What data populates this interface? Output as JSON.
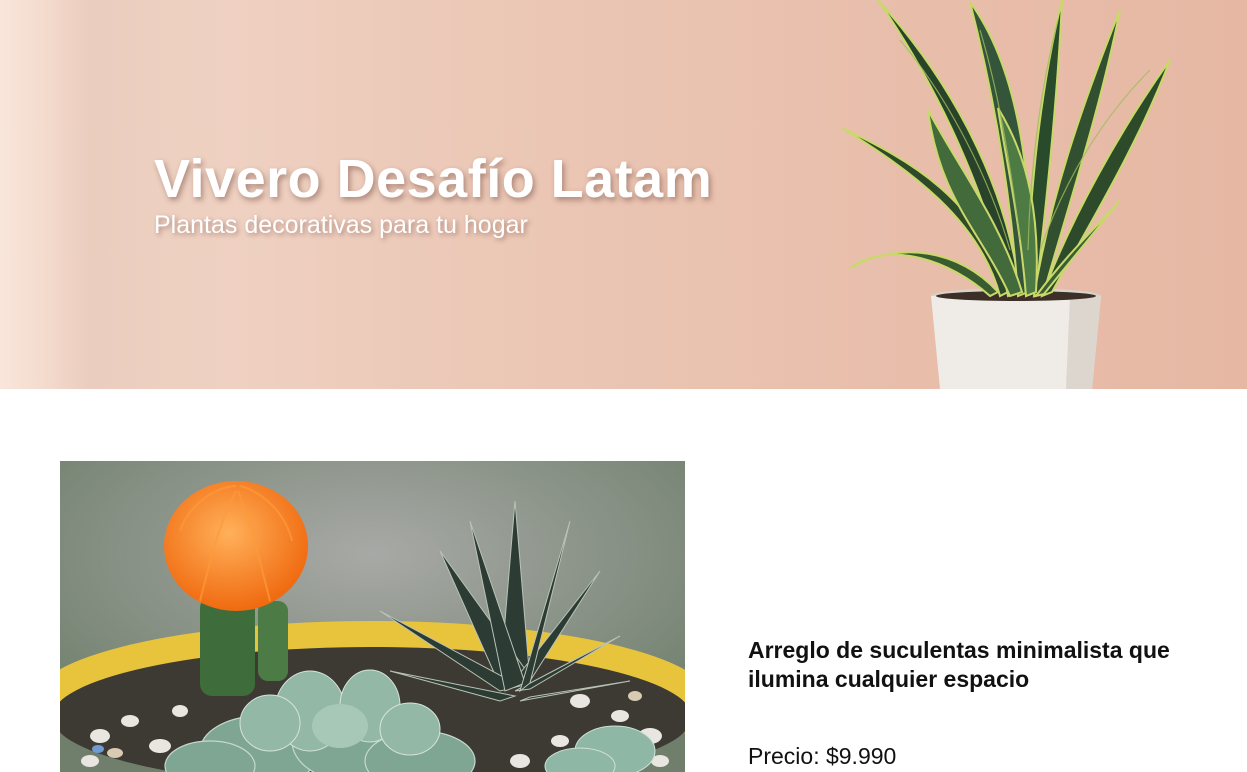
{
  "hero": {
    "title": "Vivero Desafío Latam",
    "subtitle": "Plantas decorativas para tu hogar",
    "image_icon": "snake-plant-icon"
  },
  "product": {
    "name": "Arreglo de suculentas minimalista que ilumina cualquier espacio",
    "price": "Precio: $9.990",
    "image_icon": "succulent-arrangement-icon"
  }
}
